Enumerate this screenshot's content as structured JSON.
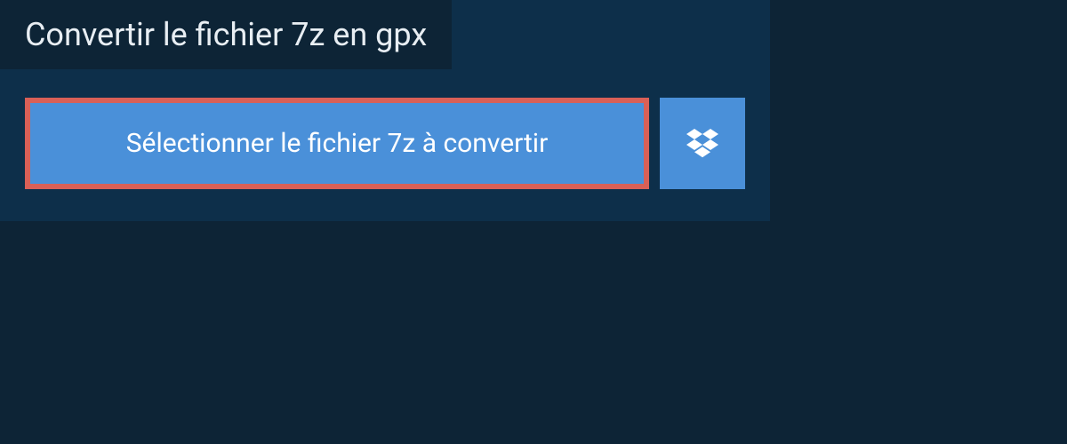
{
  "header": {
    "title": "Convertir le fichier 7z en gpx"
  },
  "actions": {
    "select_file_label": "Sélectionner le fichier 7z à convertir"
  }
}
